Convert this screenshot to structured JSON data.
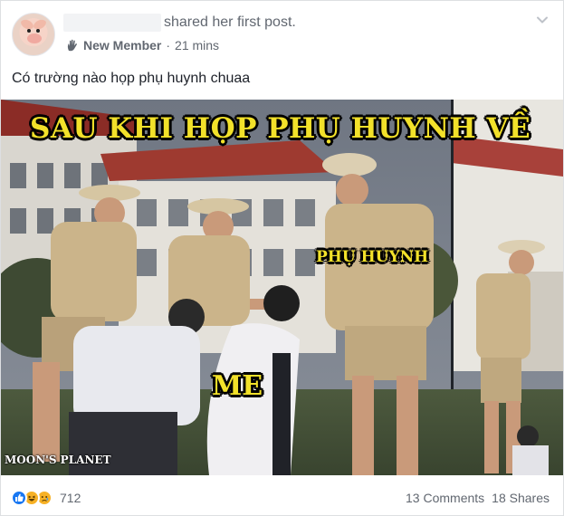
{
  "post": {
    "author_action": "shared her first post.",
    "badge": "New Member",
    "time": "21 mins",
    "text": "Có trường nào họp phụ huynh chuaa",
    "image": {
      "caption_top": "SAU KHI HỌP PHỤ HUYNH VỀ",
      "label_parent": "PHỤ HUYNH",
      "label_me": "ME",
      "watermark": "MOON'S PLANET"
    }
  },
  "footer": {
    "reactions": [
      "like",
      "haha",
      "sad"
    ],
    "reaction_count": "712",
    "comments": "13 Comments",
    "shares": "18 Shares"
  },
  "colors": {
    "caption": "#f2e12a",
    "like": "#1877f2",
    "meta_text": "#616770"
  }
}
